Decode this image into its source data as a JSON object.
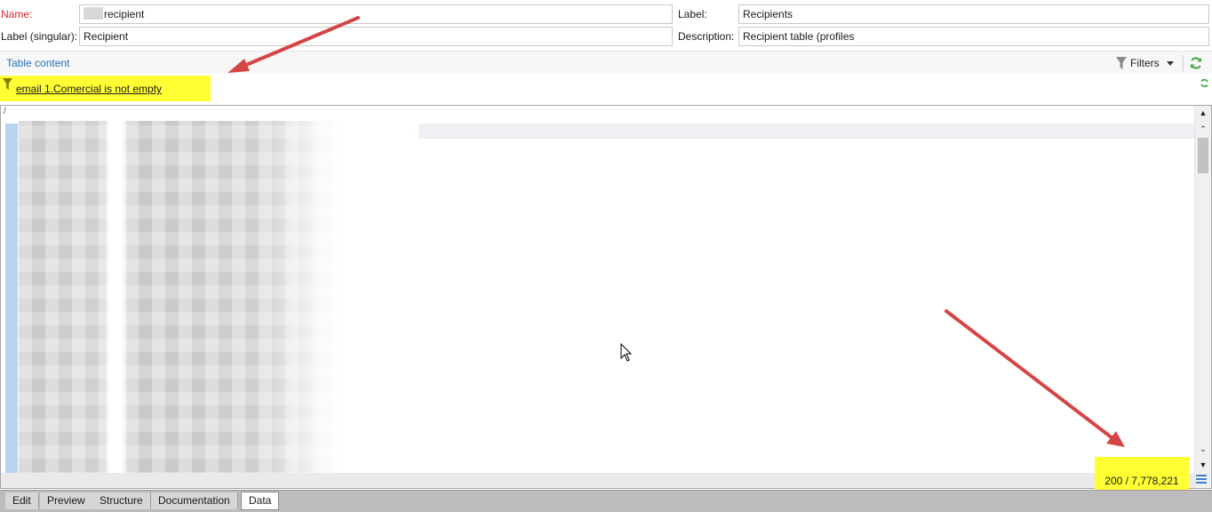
{
  "form": {
    "name_label": "Name:",
    "name_value": "recipient",
    "label_label": "Label:",
    "label_value": "Recipients",
    "label_singular_label": "Label (singular):",
    "label_singular_value": "Recipient",
    "description_label": "Description:",
    "description_value": "Recipient table (profiles"
  },
  "section": {
    "title": "Table content",
    "filters_label": "Filters"
  },
  "filter": {
    "text": "email 1.Comercial is not empty",
    "highlight_color": "#ffff33"
  },
  "grid": {
    "header_mark": "/"
  },
  "count": {
    "text": "200 / 7,778,221"
  },
  "tabs": [
    {
      "label": "Edit",
      "active": false
    },
    {
      "label": "Preview",
      "active": false
    },
    {
      "label": "Structure",
      "active": false
    },
    {
      "label": "Documentation",
      "active": false
    },
    {
      "label": "Data",
      "active": true
    }
  ],
  "colors": {
    "accent_link": "#2a6ebb",
    "required_label": "#d9252b",
    "annotation_arrow": "#d64545",
    "refresh_green": "#3aa53a"
  },
  "icons": {
    "filter": "funnel-icon",
    "refresh": "refresh-icon",
    "menu": "list-menu-icon"
  }
}
